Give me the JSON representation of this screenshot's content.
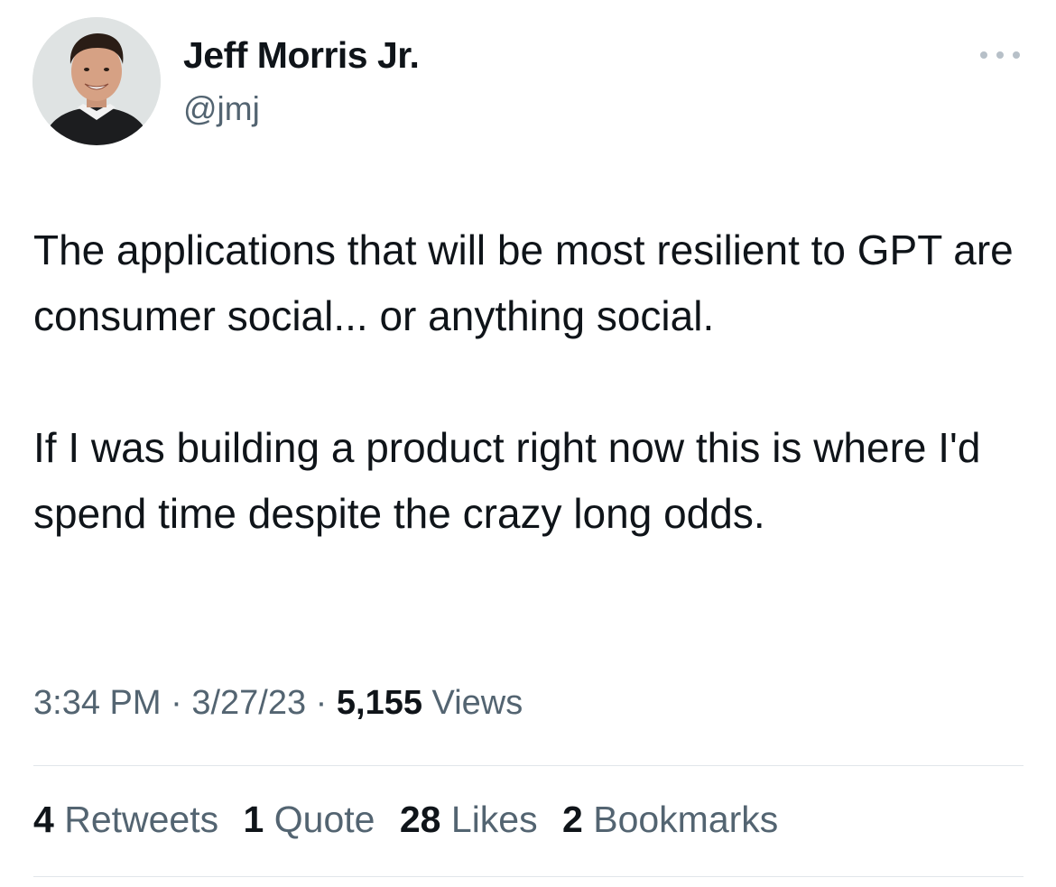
{
  "author": {
    "name": "Jeff Morris Jr.",
    "handle": "@jmj"
  },
  "tweet": {
    "paragraphs": [
      "The applications that will be most resilient to GPT are consumer social... or anything social.",
      "If I was building a product right now this is where I'd spend time despite the crazy long odds."
    ]
  },
  "meta": {
    "time": "3:34 PM",
    "date": "3/27/23",
    "separator": "·",
    "views_count": "5,155",
    "views_label": "Views"
  },
  "stats": {
    "retweets": {
      "count": "4",
      "label": "Retweets"
    },
    "quotes": {
      "count": "1",
      "label": "Quote"
    },
    "likes": {
      "count": "28",
      "label": "Likes"
    },
    "bookmarks": {
      "count": "2",
      "label": "Bookmarks"
    }
  },
  "icons": {
    "more": "more-horizontal-icon"
  },
  "colors": {
    "text_primary": "#0f1419",
    "text_secondary": "#536471",
    "divider": "#e1e6ea"
  }
}
